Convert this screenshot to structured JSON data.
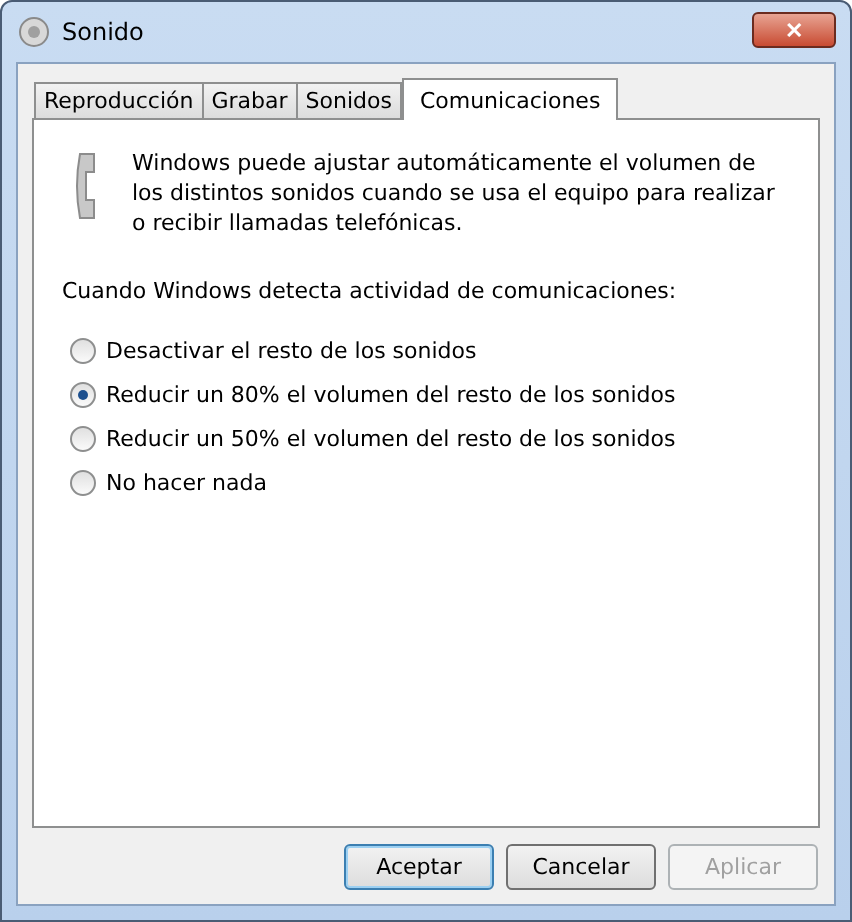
{
  "window": {
    "title": "Sonido",
    "close": "✕"
  },
  "tabs": [
    {
      "label": "Reproducción",
      "selected": false
    },
    {
      "label": "Grabar",
      "selected": false
    },
    {
      "label": "Sonidos",
      "selected": false
    },
    {
      "label": "Comunicaciones",
      "selected": true
    }
  ],
  "intro": "Windows puede ajustar automáticamente el volumen de los distintos sonidos cuando se usa el equipo para realizar o recibir llamadas telefónicas.",
  "prompt": "Cuando Windows detecta actividad de comunicaciones:",
  "options": [
    {
      "label": "Desactivar el resto de los sonidos",
      "selected": false
    },
    {
      "label": "Reducir un 80% el volumen del resto de los sonidos",
      "selected": true
    },
    {
      "label": "Reducir un 50% el volumen del resto de los sonidos",
      "selected": false
    },
    {
      "label": "No hacer nada",
      "selected": false
    }
  ],
  "buttons": [
    {
      "label": "Aceptar",
      "default": true,
      "disabled": false
    },
    {
      "label": "Cancelar",
      "default": false,
      "disabled": false
    },
    {
      "label": "Aplicar",
      "default": false,
      "disabled": true
    }
  ]
}
